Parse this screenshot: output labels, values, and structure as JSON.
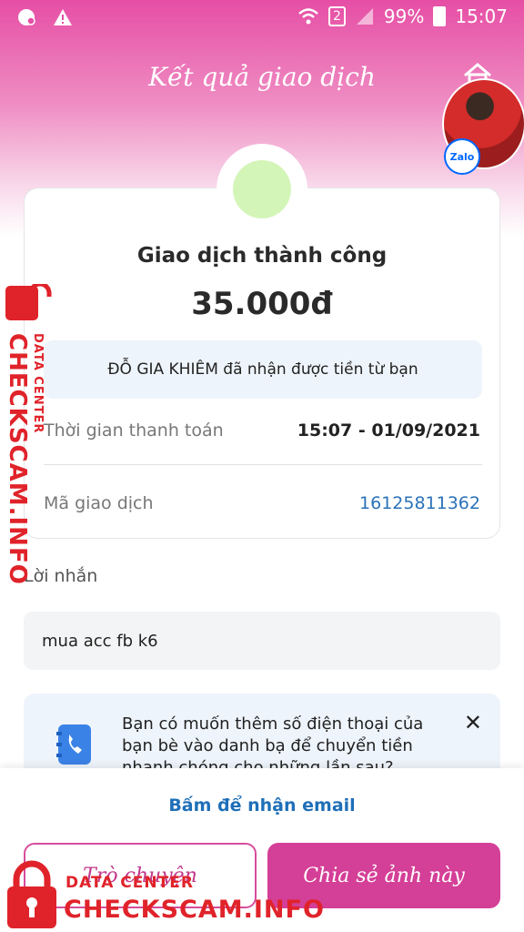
{
  "status_bar": {
    "battery": "99%",
    "time": "15:07",
    "sim": "2"
  },
  "header": {
    "title": "Kết quả giao dịch"
  },
  "receipt": {
    "status": "Giao dịch thành công",
    "amount": "35.000đ",
    "receiver_message": "ĐỖ GIA KHIÊM đã nhận được tiền từ bạn",
    "time_label": "Thời gian thanh toán",
    "time_value": "15:07 - 01/09/2021",
    "txn_label": "Mã giao dịch",
    "txn_value": "16125811362"
  },
  "note": {
    "label": "Lời nhắn",
    "value": "mua acc fb k6"
  },
  "suggestion": {
    "text": "Bạn có muốn thêm số điện thoại của bạn bè vào danh bạ để chuyển tiền nhanh chóng cho những lần sau?"
  },
  "actions": {
    "email_link": "Bấm để nhận email",
    "chat_button": "Trò chuyện",
    "share_button": "Chia sẻ ảnh này"
  },
  "avatar": {
    "badge": "Zalo"
  },
  "watermark": {
    "site": "CHECKSCAM.INFO",
    "tag": "DATA CENTER"
  },
  "colors": {
    "brand_pink": "#d43f97",
    "success_green": "#d4f5b8",
    "link_blue": "#1e6fb8",
    "watermark_red": "#e0232a"
  }
}
